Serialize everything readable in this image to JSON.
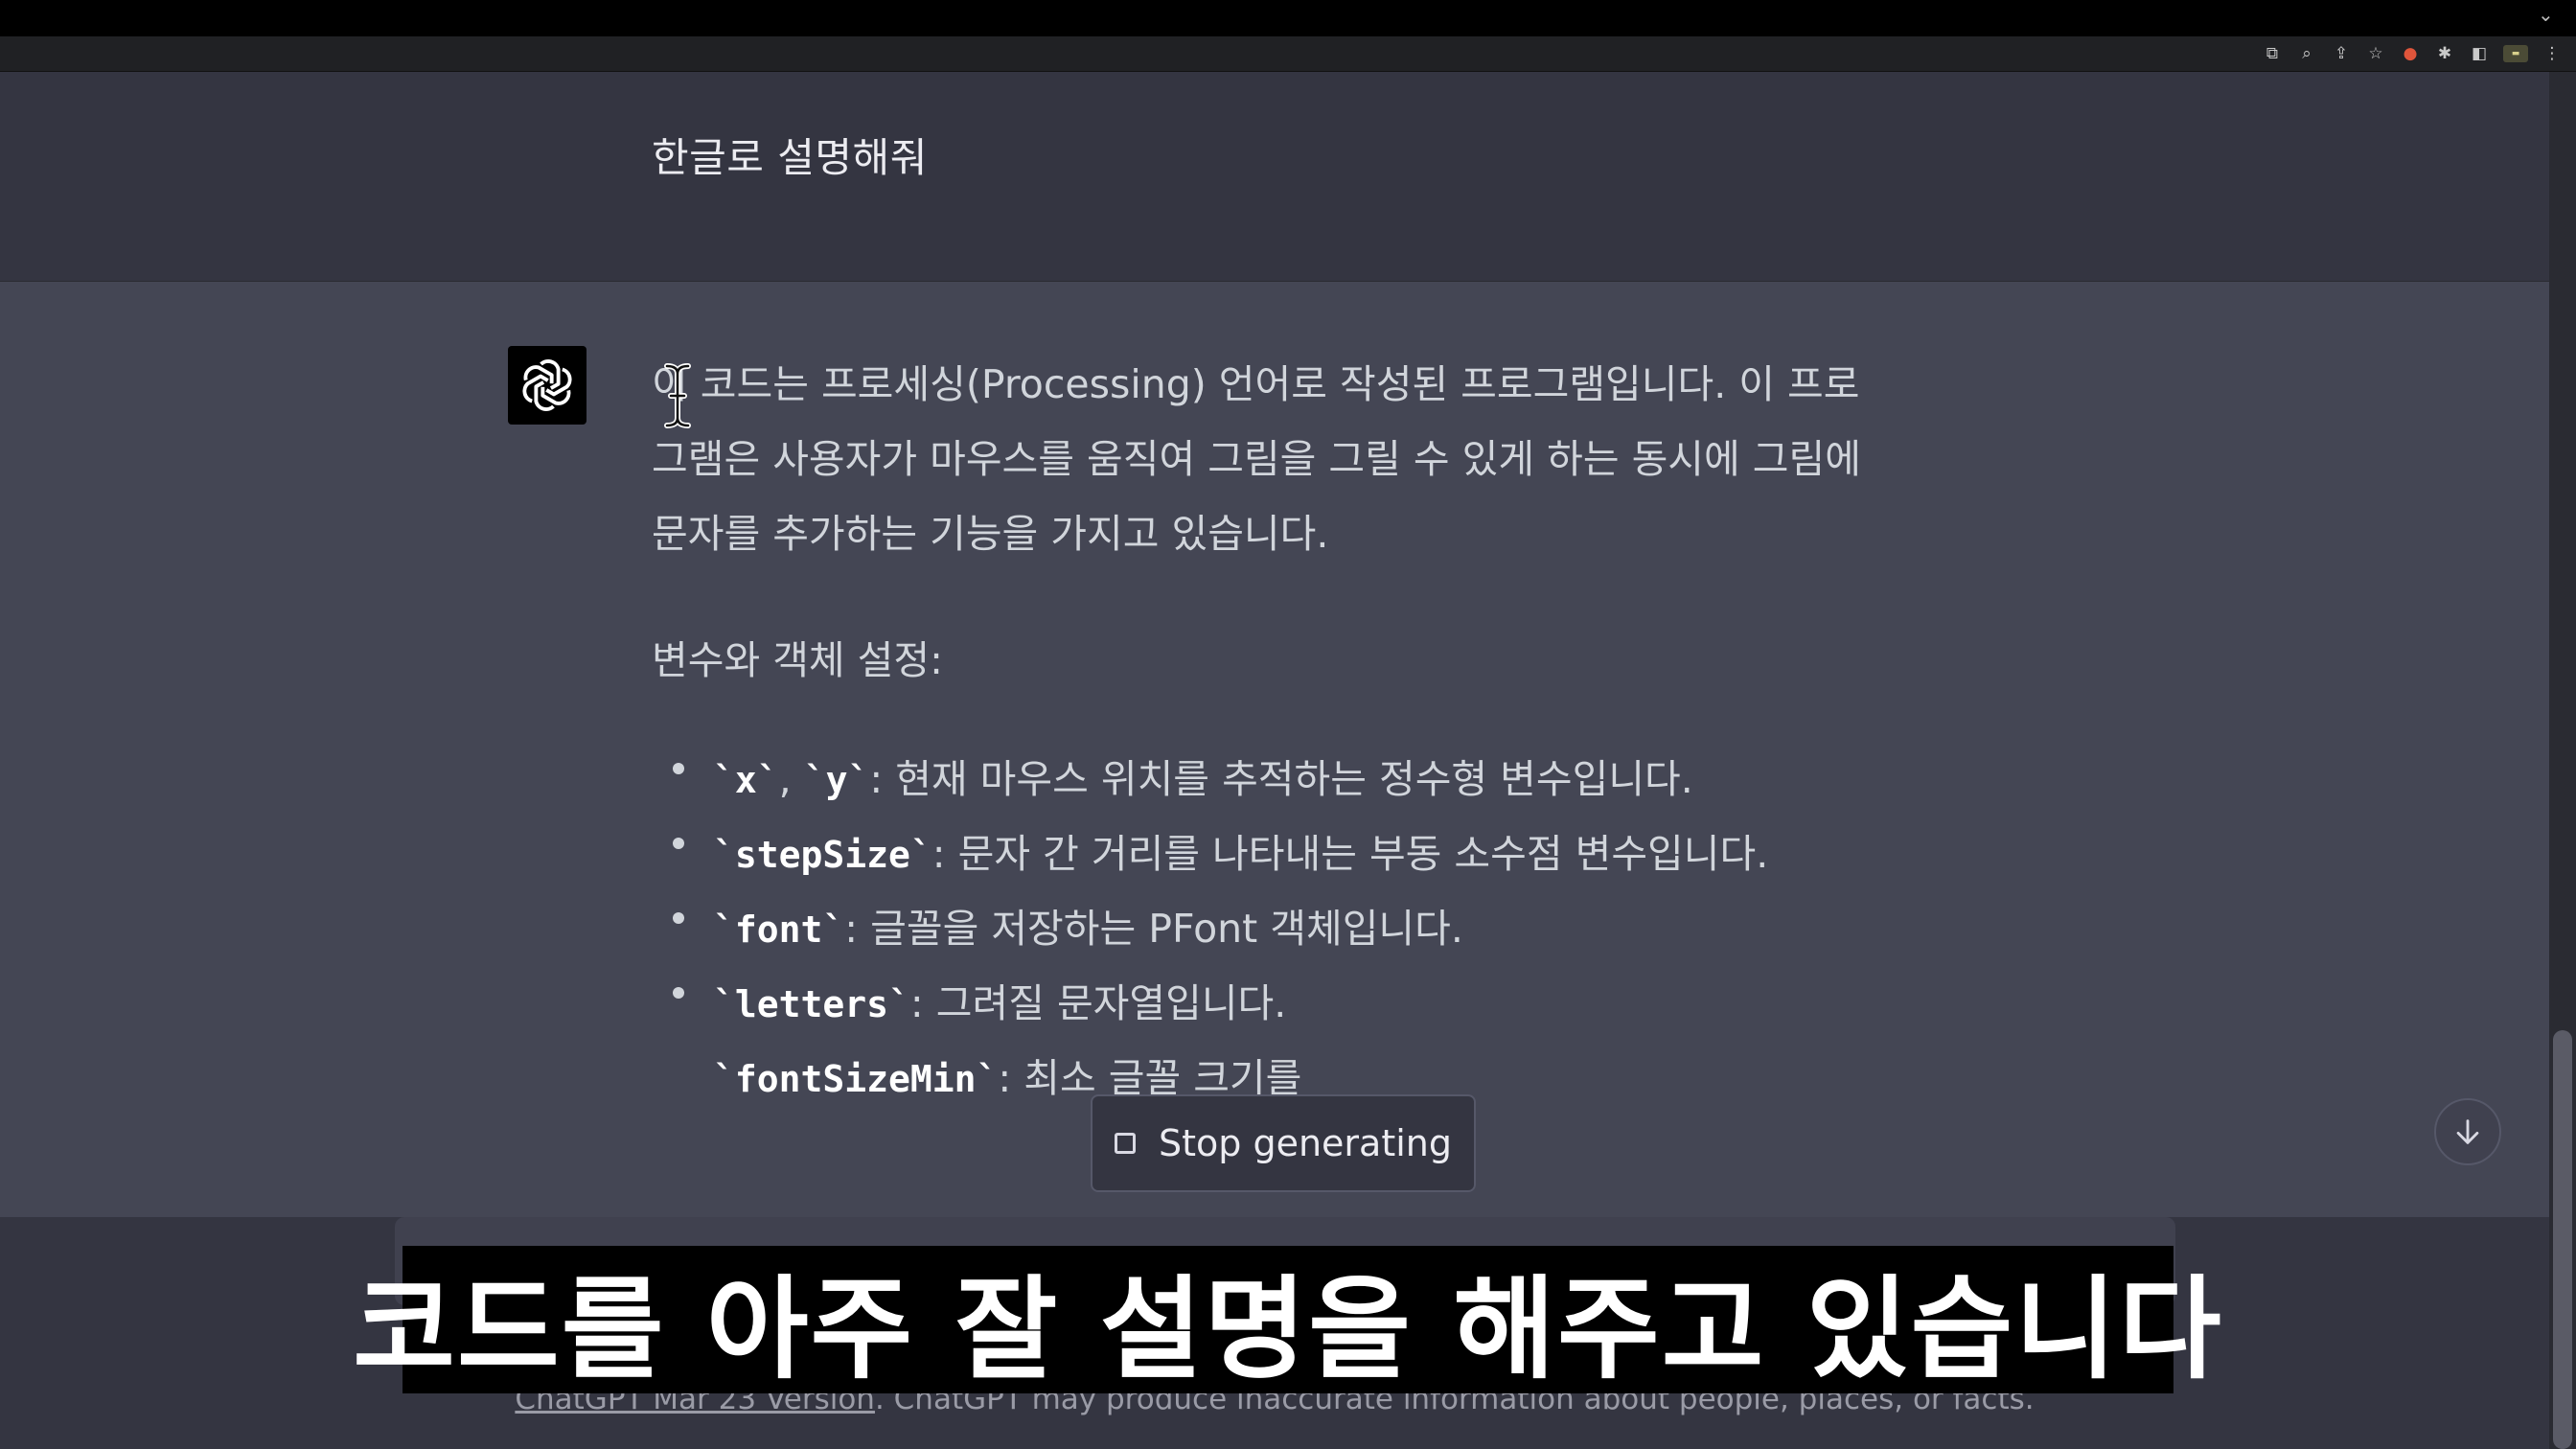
{
  "user_message": "한글로 설명해줘",
  "answer": {
    "intro": "이 코드는 프로세싱(Processing) 언어로 작성된 프로그램입니다. 이 프로그램은 사용자가 마우스를 움직여 그림을 그릴 수 있게 하는 동시에 그림에 문자를 추가하는 기능을 가지고 있습니다.",
    "section_title": "변수와 객체 설정:",
    "items": [
      {
        "code": "`x`",
        "sep": ", ",
        "code2": "`y`",
        "desc": ": 현재 마우스 위치를 추적하는 정수형 변수입니다."
      },
      {
        "code": "`stepSize`",
        "desc": ": 문자 간 거리를 나타내는 부동 소수점 변수입니다."
      },
      {
        "code": "`font`",
        "desc": ": 글꼴을 저장하는 PFont 객체입니다."
      },
      {
        "code": "`letters`",
        "desc": ": 그려질 문자열입니다."
      },
      {
        "code": "`fontSizeMin`",
        "desc": ": 최소 글꼴 크기를"
      }
    ]
  },
  "stop_button": {
    "label": "Stop generating"
  },
  "footer": {
    "link": "ChatGPT Mar 23 Version",
    "text": ". ChatGPT may produce inaccurate information about people, places, or facts."
  },
  "caption": "코드를 아주 잘 설명을 해주고 있습니다",
  "icons": {
    "assistant_avatar": "openai-logo-icon",
    "scroll_down": "arrow-down-icon",
    "stop": "stop-square-icon"
  },
  "colors": {
    "assistant_bg": "#444654",
    "user_bg": "#343541",
    "caption_bg": "#000000"
  }
}
